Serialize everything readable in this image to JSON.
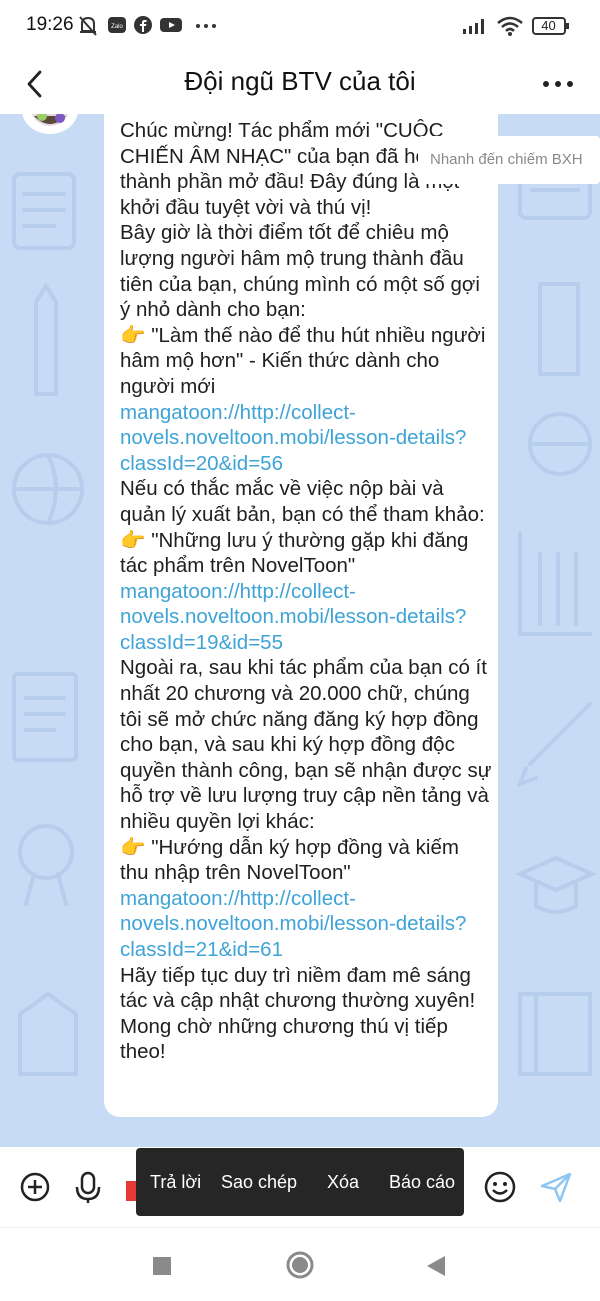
{
  "status_bar": {
    "time": "19:26",
    "battery": "40",
    "icons": [
      "muted-bell-icon",
      "zalo-icon",
      "facebook-icon",
      "youtube-icon",
      "more-dots-icon",
      "signal-icon",
      "wifi-icon",
      "battery-icon"
    ]
  },
  "header": {
    "title": "Đội ngũ BTV của tôi"
  },
  "message": {
    "lines": [
      {
        "type": "text",
        "text": "Chúc mừng! Tác phẩm mới \"CUỘC CHIẾN ÂM NHẠC\" của bạn đã hoàn thành phần mở đầu! Đây đúng là một khởi đầu tuyệt vời và thú vị!"
      },
      {
        "type": "text",
        "text": "Bây giờ là thời điểm tốt để chiêu mộ lượng người hâm mộ trung thành đầu tiên của bạn, chúng mình có một số gợi ý nhỏ dành cho bạn:"
      },
      {
        "type": "text",
        "text": "👉 \"Làm thế nào để thu hút nhiều người hâm mộ hơn\" - Kiến thức dành cho người mới"
      },
      {
        "type": "link",
        "text": "mangatoon://http://collect-novels.noveltoon.mobi/lesson-details?classId=20&id=56"
      },
      {
        "type": "text",
        "text": "Nếu có thắc mắc về việc nộp bài và quản lý xuất bản, bạn có thể tham khảo:"
      },
      {
        "type": "text",
        "text": "👉 \"Những lưu ý thường gặp khi đăng tác phẩm trên NovelToon\""
      },
      {
        "type": "link",
        "text": "mangatoon://http://collect-novels.noveltoon.mobi/lesson-details?classId=19&id=55"
      },
      {
        "type": "text",
        "text": "Ngoài ra, sau khi tác phẩm của bạn có ít nhất 20 chương và 20.000 chữ, chúng tôi sẽ mở chức năng đăng ký hợp đồng cho bạn, và sau khi ký hợp đồng độc quyền thành công, bạn sẽ nhận được sự hỗ trợ về lưu lượng truy cập nền tảng và nhiều quyền lợi khác:"
      },
      {
        "type": "text",
        "text": "👉 \"Hướng dẫn ký hợp đồng và kiếm thu nhập trên NovelToon\""
      },
      {
        "type": "link",
        "text": "mangatoon://http://collect-novels.noveltoon.mobi/lesson-details?classId=21&id=61"
      },
      {
        "type": "text",
        "text": "Hãy tiếp tục duy trì niềm đam mê sáng tác và cập nhật chương thường xuyên! Mong chờ những chương thú vị tiếp theo!"
      }
    ]
  },
  "toast": {
    "text": "Nhanh đến chiếm BXH"
  },
  "context_menu": {
    "reply": "Trả lời",
    "copy": "Sao chép",
    "delete": "Xóa",
    "report": "Báo cáo"
  },
  "colors": {
    "chat_background": "#c8dbf5",
    "link": "#3ea3d6",
    "context_menu_bg": "#262626",
    "send_icon": "#8ec5f2"
  }
}
